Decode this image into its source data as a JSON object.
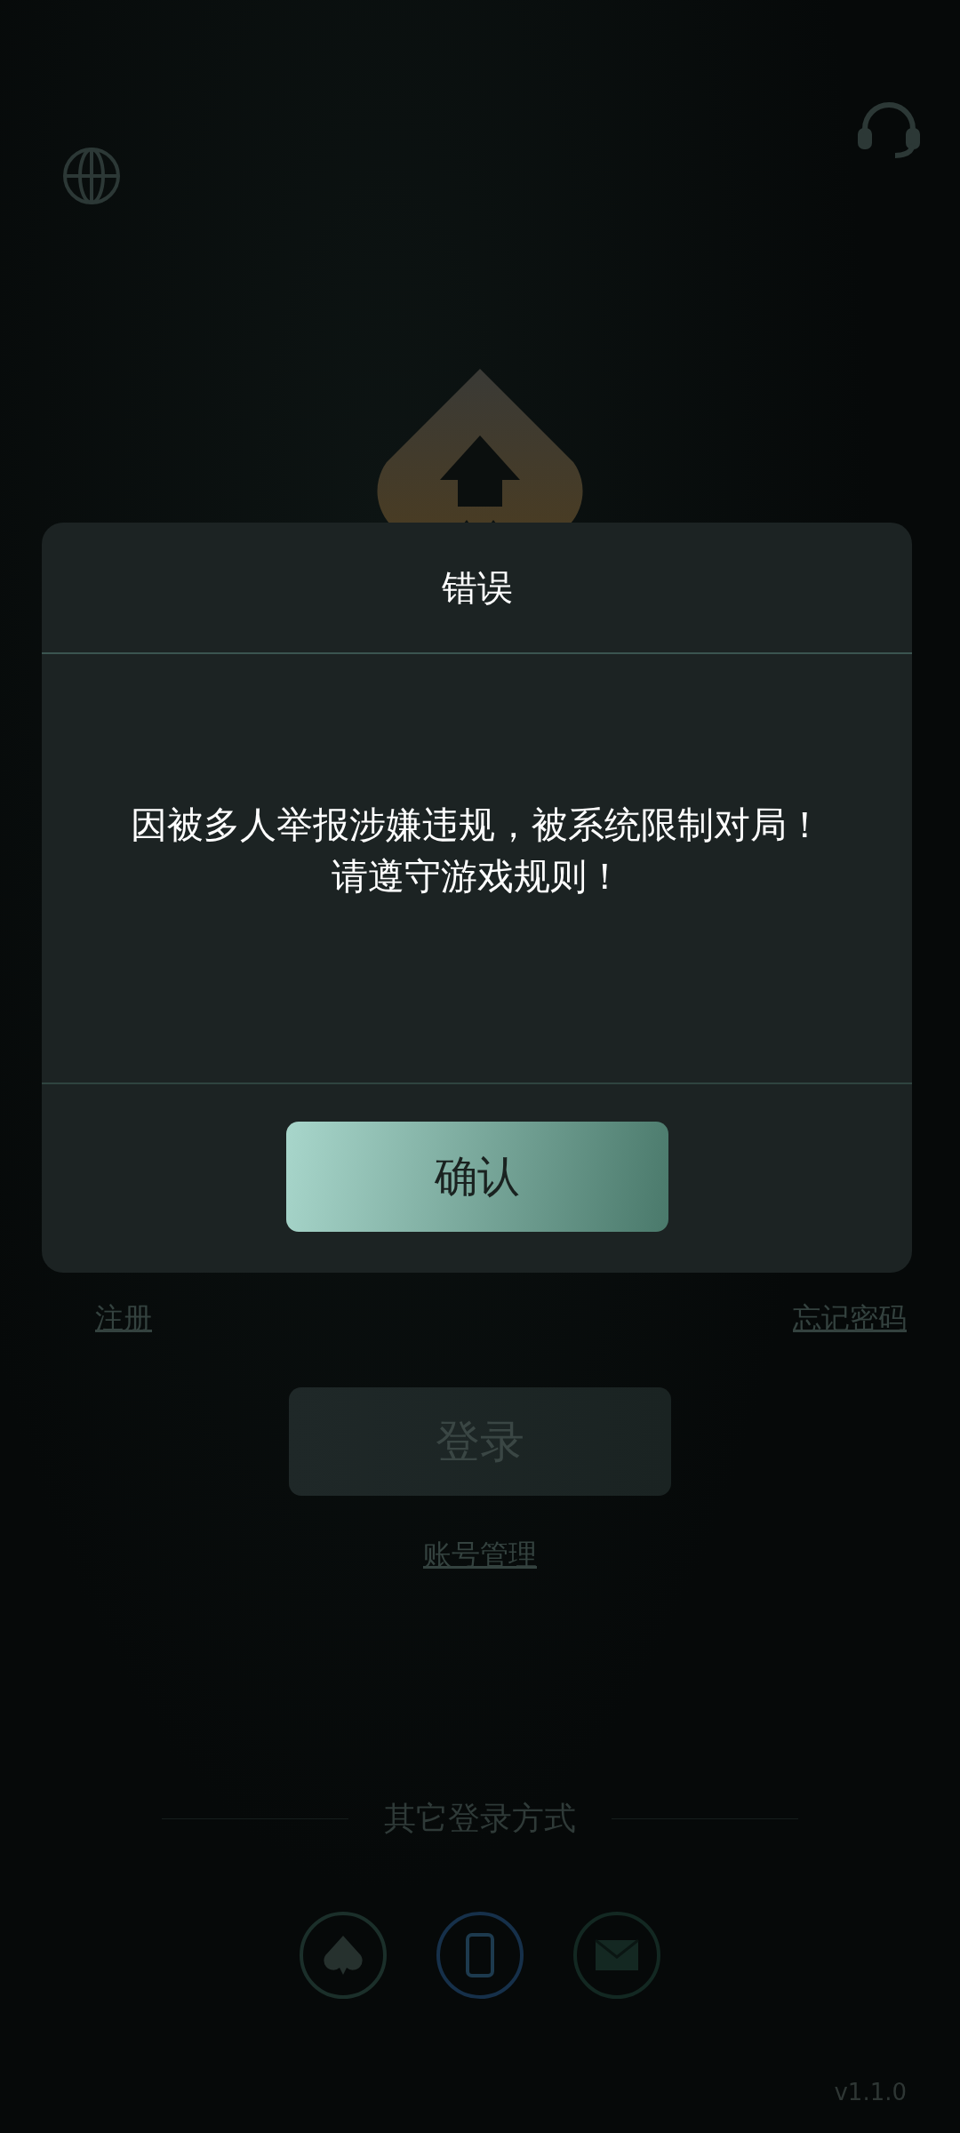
{
  "background": {
    "links": [
      "注册",
      "忘记密码"
    ],
    "login_button": "登录",
    "account_link": "账号管理",
    "other_login": {
      "label": "其它登录方式",
      "methods": [
        {
          "kind": "spade"
        },
        {
          "kind": "phone"
        },
        {
          "kind": "mail"
        }
      ]
    },
    "version": "v1.1.0"
  },
  "dialog": {
    "title": "错误",
    "message": [
      "因被多人举报涉嫌违规，被系统限制对局！",
      "请遵守游戏规则！"
    ],
    "button": "确认"
  }
}
